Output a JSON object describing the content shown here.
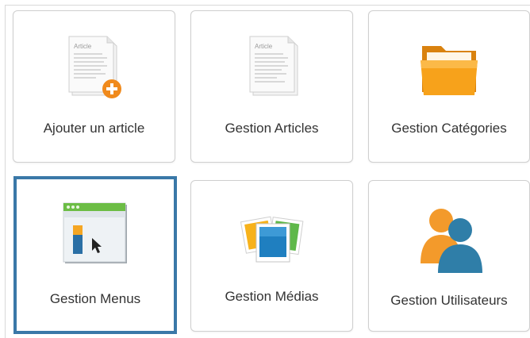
{
  "tiles": [
    {
      "label": "Ajouter un article",
      "icon": "article-add-icon",
      "selected": false
    },
    {
      "label": "Gestion Articles",
      "icon": "article-icon",
      "selected": false
    },
    {
      "label": "Gestion Catégories",
      "icon": "folder-icon",
      "selected": false
    },
    {
      "label": "Gestion Menus",
      "icon": "menu-window-icon",
      "selected": true
    },
    {
      "label": "Gestion Médias",
      "icon": "media-images-icon",
      "selected": false
    },
    {
      "label": "Gestion Utilisateurs",
      "icon": "users-icon",
      "selected": false
    }
  ],
  "icon_text": {
    "article": "Article"
  },
  "colors": {
    "selected_border": "#3a78a8",
    "folder": "#f7a21b",
    "add_badge": "#f08a1c",
    "users_orange": "#f39a2b",
    "users_blue": "#2f7ea8",
    "menu_bar_green": "#6cbd45"
  }
}
